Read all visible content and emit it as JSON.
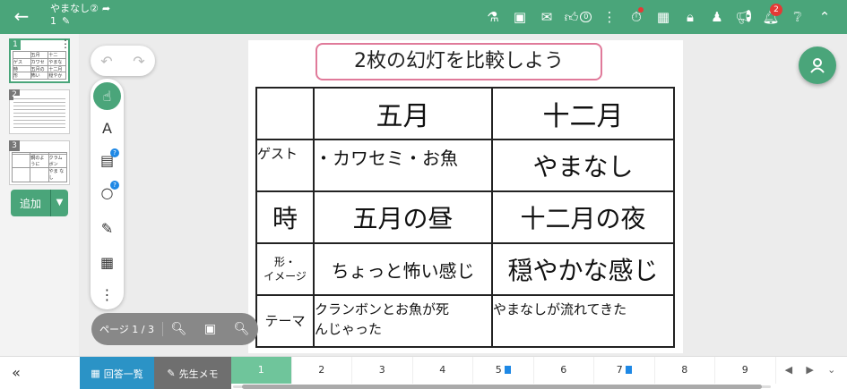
{
  "header": {
    "title": "やまなし②",
    "subtitle": "1",
    "like_count": "0",
    "notification_count": "2"
  },
  "thumbnails": [
    {
      "num": "1",
      "cells": [
        "",
        "五月",
        "十二",
        "ゲス",
        "カワセミ",
        "やまな",
        "時",
        "五月の昼",
        "十二月の夜",
        "形",
        "怖い",
        "穏やか"
      ]
    },
    {
      "num": "2"
    },
    {
      "num": "3",
      "cells": [
        "",
        "",
        "",
        "",
        "鋼のよ\nうに",
        "クラム\nボン",
        "",
        "",
        "やま\nなし"
      ]
    }
  ],
  "sidebar": {
    "add_label": "追加"
  },
  "slide": {
    "title": "2枚の幻灯を比較しよう",
    "header_row": [
      "",
      "五月",
      "十二月"
    ],
    "rows": [
      [
        "ゲスト",
        "・カワセミ・お魚",
        "やまなし"
      ],
      [
        "時",
        "五月の昼",
        "十二月の夜"
      ],
      [
        "形・\nイメージ",
        "ちょっと怖い感じ",
        "穏やかな感じ"
      ],
      [
        "テーマ",
        "クランボンとお魚が死\nんじゃった",
        "やまなしが流れてきた"
      ]
    ]
  },
  "pagebar": {
    "label": "ページ 1 / 3"
  },
  "bottom": {
    "answers_label": "回答一覧",
    "memo_label": "先生メモ",
    "tabs": [
      "1",
      "2",
      "3",
      "4",
      "5",
      "6",
      "7",
      "8",
      "9"
    ],
    "active_tab": "1"
  },
  "colors": {
    "brand": "#4aa57a",
    "answers": "#2b93c6",
    "title_border": "#e07a9a"
  }
}
